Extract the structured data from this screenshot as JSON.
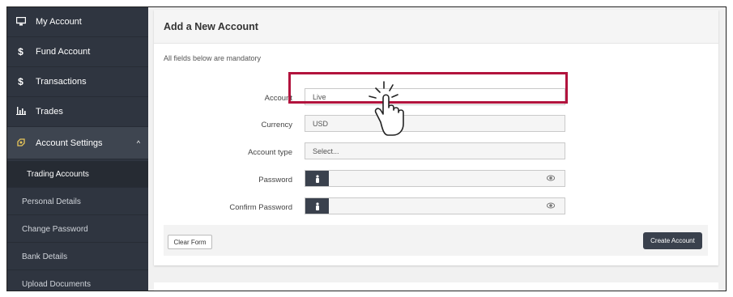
{
  "sidebar": {
    "items": [
      {
        "label": "My Account",
        "icon": "monitor-icon"
      },
      {
        "label": "Fund Account",
        "icon": "dollar-icon"
      },
      {
        "label": "Transactions",
        "icon": "dollar-icon"
      },
      {
        "label": "Trades",
        "icon": "bar-chart-icon"
      },
      {
        "label": "Account Settings",
        "icon": "settings-icon"
      }
    ],
    "subitems": [
      {
        "label": "Trading Accounts"
      },
      {
        "label": "Personal Details"
      },
      {
        "label": "Change Password"
      },
      {
        "label": "Bank Details"
      },
      {
        "label": "Upload Documents"
      }
    ]
  },
  "panel": {
    "title": "Add a New Account",
    "note": "All fields below are mandatory"
  },
  "form": {
    "account_label": "Account",
    "account_value": "Live",
    "currency_label": "Currency",
    "currency_value": "USD",
    "account_type_label": "Account type",
    "account_type_value": "Select...",
    "password_label": "Password",
    "confirm_password_label": "Confirm Password"
  },
  "buttons": {
    "clear": "Clear Form",
    "create": "Create Account"
  },
  "colors": {
    "sidebar_bg": "#2f3540",
    "highlight": "#b2133d",
    "button_dark": "#3a414d"
  }
}
